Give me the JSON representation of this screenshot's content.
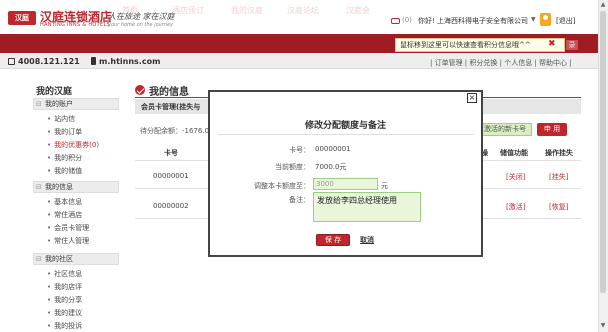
{
  "header": {
    "logo_badge": "汉庭",
    "logo_cn": "汉庭连锁酒店",
    "logo_en": "HANTING INNS & HOTELS",
    "slogan": "人在旅途 家在汉庭",
    "slogan_en": "your home on the journey",
    "msg_count": "(0)",
    "hello": "你好!",
    "company": "上海西科得电子安全有限公司",
    "logout": "[退出]"
  },
  "nav": {
    "items": [
      "首页",
      "酒店预订",
      "我的汉庭",
      "汉庭论坛",
      "汉庭会"
    ],
    "tooltip": "鼠标移到这里可以快速查看积分信息哦^^",
    "login_short": "录"
  },
  "subbar": {
    "phone": "4008.121.121",
    "mobile_site": "m.htinns.com",
    "quick_links": "| 订单管理 | 积分兑换 | 个人信息 | 帮助中心 |"
  },
  "sidebar": {
    "title": "我的汉庭",
    "sections": [
      {
        "title": "我的账户",
        "items": [
          "站内信",
          "我的订单",
          "我的优惠券(0)",
          "我的积分",
          "我的储值"
        ]
      },
      {
        "title": "我的信息",
        "items": [
          "基本信息",
          "常住酒店",
          "会员卡管理",
          "常住人管理"
        ]
      },
      {
        "title": "我的社区",
        "items": [
          "社区信息",
          "我的店评",
          "我的分享",
          "我的建议",
          "我的投诉"
        ]
      }
    ]
  },
  "main": {
    "title": "我的信息",
    "subheader": "会员卡管理(挂失与",
    "pending_prefix": "待分配余额：-1676.0",
    "btn_activate": "激活的新卡号",
    "btn_apply": "申 用",
    "columns": {
      "card": "卡号",
      "op": "操",
      "store": "储值功能",
      "suspend": "操作挂失"
    },
    "rows": [
      {
        "card": "00000001",
        "store": "[关闭]",
        "suspend": "[挂失]"
      },
      {
        "card": "00000002",
        "store": "[激活]",
        "suspend": "[恢复]"
      }
    ]
  },
  "modal": {
    "close": "×",
    "title": "修改分配额度与备注",
    "card_label": "卡号：",
    "card_value": "00000001",
    "current_label": "当前额度：",
    "current_value": "7000.0元",
    "adjust_label": "调整本卡额度至：",
    "adjust_placeholder": "3000",
    "adjust_unit": "元",
    "remark_label": "备注：",
    "remark_value": "发放给李四总经理使用",
    "save": "保 存",
    "cancel": "取消"
  },
  "colors": {
    "brand_red": "#c0272d",
    "nav_red": "#9f1d22",
    "input_green": "#e9f6dc"
  }
}
